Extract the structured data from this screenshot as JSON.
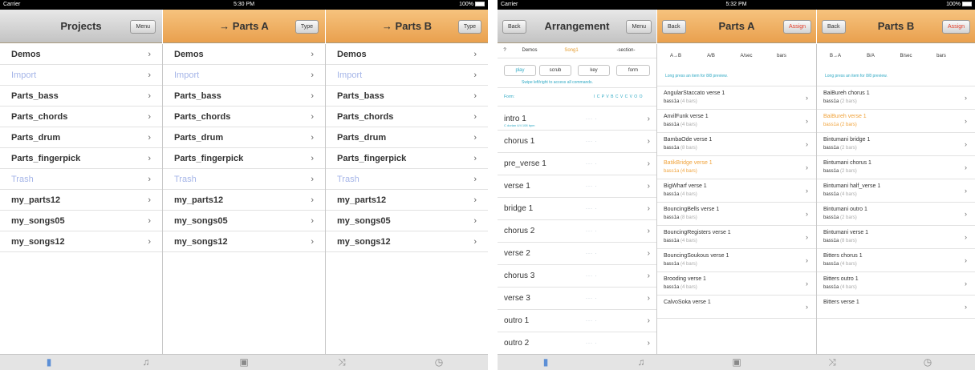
{
  "screen1": {
    "status": {
      "carrier": "Carrier",
      "time": "5:30 PM",
      "battery": "100%"
    },
    "columns": [
      {
        "title": "Projects",
        "button": "Menu"
      },
      {
        "title": "→ Parts A",
        "button": "Type"
      },
      {
        "title": "→ Parts B",
        "button": "Type"
      }
    ],
    "items": [
      "Demos",
      "Import",
      "Parts_bass",
      "Parts_chords",
      "Parts_drum",
      "Parts_fingerpick",
      "Trash",
      "my_parts12",
      "my_songs05",
      "my_songs12"
    ]
  },
  "screen2": {
    "status": {
      "carrier": "Carrier",
      "time": "5:32 PM",
      "battery": "100%"
    },
    "arrangement": {
      "back": "Back",
      "title": "Arrangement",
      "menu": "Menu",
      "crumbs": [
        "?",
        "Demos",
        "Song1",
        "-section-"
      ],
      "controls": [
        "play",
        "scrub",
        "key",
        "form"
      ],
      "hint": "Swipe left/right to access all commands.",
      "form_label": "Form:",
      "form_seq": "I C P V B C V C V O O",
      "rows": [
        {
          "label": "intro 1",
          "sub": "C dorian 4/4 108 bpm"
        },
        {
          "label": "chorus 1"
        },
        {
          "label": "pre_verse 1"
        },
        {
          "label": "verse 1"
        },
        {
          "label": "bridge 1"
        },
        {
          "label": "chorus 2"
        },
        {
          "label": "verse 2"
        },
        {
          "label": "chorus 3"
        },
        {
          "label": "verse 3"
        },
        {
          "label": "outro 1"
        },
        {
          "label": "outro 2"
        }
      ]
    },
    "partsA": {
      "back": "Back",
      "title": "Parts A",
      "assign": "Assign",
      "segments": [
        "A→B",
        "A/B",
        "A/sec",
        "bars"
      ],
      "hint": "Long press an item for 8/8 preview.",
      "rows": [
        {
          "name": "AngularStaccato",
          "sec": "verse 1",
          "inst": "bass1a",
          "bars": "(4 bars)"
        },
        {
          "name": "AnvilFunk",
          "sec": "verse 1",
          "inst": "bass1a",
          "bars": "(4 bars)"
        },
        {
          "name": "BambaOde",
          "sec": "verse 1",
          "inst": "bass1a",
          "bars": "(8 bars)"
        },
        {
          "name": "BatikBridge",
          "sec": "verse 1",
          "inst": "bass1a",
          "bars": "(4 bars)",
          "selected": true
        },
        {
          "name": "BigWharf",
          "sec": "verse 1",
          "inst": "bass1a",
          "bars": "(4 bars)"
        },
        {
          "name": "BouncingBells",
          "sec": "verse 1",
          "inst": "bass1a",
          "bars": "(8 bars)"
        },
        {
          "name": "BouncingRegisters",
          "sec": "verse 1",
          "inst": "bass1a",
          "bars": "(4 bars)"
        },
        {
          "name": "BouncingSoukous",
          "sec": "verse 1",
          "inst": "bass1a",
          "bars": "(4 bars)"
        },
        {
          "name": "Brooding",
          "sec": "verse 1",
          "inst": "bass1a",
          "bars": "(4 bars)"
        },
        {
          "name": "CalvoSoka",
          "sec": "verse 1",
          "inst": "",
          "bars": ""
        }
      ]
    },
    "partsB": {
      "back": "Back",
      "title": "Parts B",
      "assign": "Assign",
      "segments": [
        "B→A",
        "B/A",
        "B/sec",
        "bars"
      ],
      "hint": "Long press an item for 8/8 preview.",
      "rows": [
        {
          "name": "BaiBureh",
          "sec": "chorus 1",
          "inst": "bass1a",
          "bars": "(2 bars)"
        },
        {
          "name": "BaiBureh",
          "sec": "verse 1",
          "inst": "bass1a",
          "bars": "(2 bars)",
          "selected": true
        },
        {
          "name": "Bintumani",
          "sec": "bridge 1",
          "inst": "bass1a",
          "bars": "(2 bars)"
        },
        {
          "name": "Bintumani",
          "sec": "chorus 1",
          "inst": "bass1a",
          "bars": "(2 bars)"
        },
        {
          "name": "Bintumani",
          "sec": "half_verse 1",
          "inst": "bass1a",
          "bars": "(4 bars)"
        },
        {
          "name": "Bintumani",
          "sec": "outro 1",
          "inst": "bass1a",
          "bars": "(2 bars)"
        },
        {
          "name": "Bintumani",
          "sec": "verse 1",
          "inst": "bass1a",
          "bars": "(8 bars)"
        },
        {
          "name": "Bitters",
          "sec": "chorus 1",
          "inst": "bass1a",
          "bars": "(4 bars)"
        },
        {
          "name": "Bitters",
          "sec": "outro 1",
          "inst": "bass1a",
          "bars": "(4 bars)"
        },
        {
          "name": "Bitters",
          "sec": "verse 1",
          "inst": "",
          "bars": ""
        }
      ]
    }
  },
  "tabs": [
    {
      "icon": "document-icon",
      "glyph": "▮"
    },
    {
      "icon": "music-note-icon",
      "glyph": "♫"
    },
    {
      "icon": "drum-icon",
      "glyph": "▣"
    },
    {
      "icon": "shuffle-icon",
      "glyph": "⤨"
    },
    {
      "icon": "clock-icon",
      "glyph": "◷"
    }
  ]
}
